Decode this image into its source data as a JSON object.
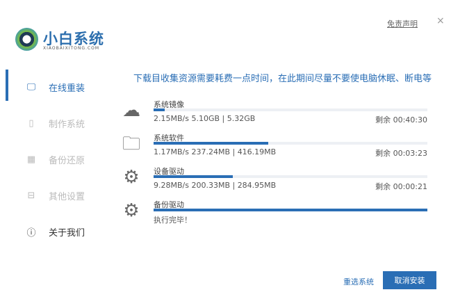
{
  "app": {
    "title": "小白系统",
    "subtitle": "XIAOBAIXITONG.COM",
    "disclaimer": "免责声明",
    "close": "×"
  },
  "sidebar": {
    "items": [
      {
        "label": "在线重装",
        "icon": "monitor-icon",
        "glyph": "🖵",
        "active": true
      },
      {
        "label": "制作系统",
        "icon": "usb-icon",
        "glyph": "▯",
        "active": false
      },
      {
        "label": "备份还原",
        "icon": "grid-icon",
        "glyph": "▦",
        "active": false
      },
      {
        "label": "其他设置",
        "icon": "box-icon",
        "glyph": "⊟",
        "active": false
      },
      {
        "label": "关于我们",
        "icon": "info-icon",
        "glyph": "ⓘ",
        "active": false
      }
    ]
  },
  "main": {
    "headline": "下载目收集资源需要耗费一点时间，在此期间尽量不要使电脑休眠、断电等",
    "items": [
      {
        "name": "系统镜像",
        "icon": "chat-icon",
        "glyph": "☁",
        "progress": 4,
        "stat": "2.15MB/s 5.10GB | 5.32GB",
        "remain": "剩余 00:40:30"
      },
      {
        "name": "系统软件",
        "icon": "folder-icon",
        "glyph": "🗀",
        "progress": 42,
        "stat": "1.17MB/s 237.24MB | 416.19MB",
        "remain": "剩余 00:03:23"
      },
      {
        "name": "设备驱动",
        "icon": "gear-icon",
        "glyph": "⚙",
        "progress": 29,
        "stat": "9.28MB/s 200.33MB | 284.95MB",
        "remain": "剩余 00:00:21"
      },
      {
        "name": "备份驱动",
        "icon": "gear-icon",
        "glyph": "⚙",
        "progress": 100,
        "stat": "执行完毕！",
        "remain": ""
      }
    ]
  },
  "footer": {
    "reselect": "重选系统",
    "cancel": "取消安装"
  },
  "colors": {
    "accent": "#2a6eb5"
  }
}
